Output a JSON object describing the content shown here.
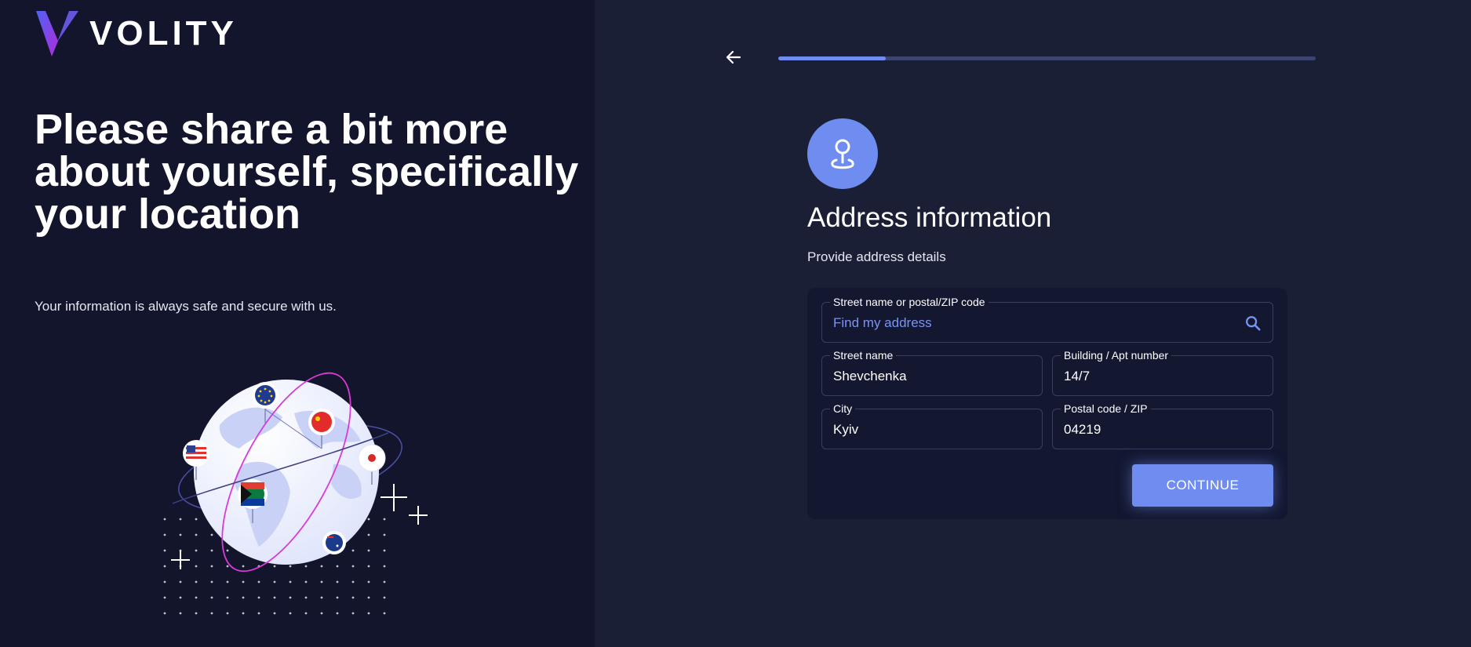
{
  "brand": {
    "name": "VOLITY"
  },
  "hero": {
    "title": "Please share a bit more about yourself, specifically your location",
    "subtitle": "Your information is always safe and secure with us."
  },
  "progress": {
    "value": 0.2
  },
  "section": {
    "icon": "location-pin-icon",
    "title": "Address information",
    "subtitle": "Provide address details"
  },
  "form": {
    "search": {
      "label": "Street name or postal/ZIP code",
      "placeholder": "Find my address"
    },
    "street": {
      "label": "Street name",
      "value": "Shevchenka"
    },
    "building": {
      "label": "Building / Apt number",
      "value": "14/7"
    },
    "city": {
      "label": "City",
      "value": "Kyiv"
    },
    "postal": {
      "label": "Postal code / ZIP",
      "value": "04219"
    },
    "continue_label": "CONTINUE"
  },
  "colors": {
    "accent": "#6f8cf0",
    "left_panel_bg": "#12152b",
    "right_panel_bg": "#1b1f36",
    "card_bg": "#131730"
  }
}
